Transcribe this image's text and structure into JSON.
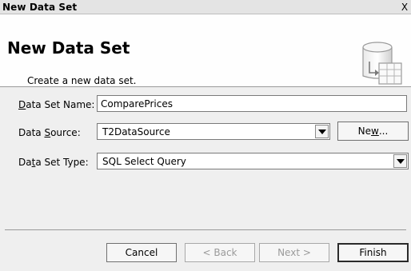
{
  "window": {
    "title": "New Data Set",
    "close_label": "X"
  },
  "banner": {
    "title": "New Data Set",
    "subtitle": "Create a new data set."
  },
  "form": {
    "name": {
      "label_mnemonic": "D",
      "label_rest": "ata Set Name:",
      "value": "ComparePrices"
    },
    "source": {
      "label_pre": "Data ",
      "label_mnemonic": "S",
      "label_rest": "ource:",
      "value": "T2DataSource",
      "new_pre": "Ne",
      "new_mnemonic": "w",
      "new_post": "..."
    },
    "type": {
      "label_pre": "Da",
      "label_mnemonic": "t",
      "label_rest": "a Set Type:",
      "value": "SQL Select Query"
    }
  },
  "footer": {
    "cancel": "Cancel",
    "back": "< Back",
    "next": "Next >",
    "finish": "Finish"
  }
}
